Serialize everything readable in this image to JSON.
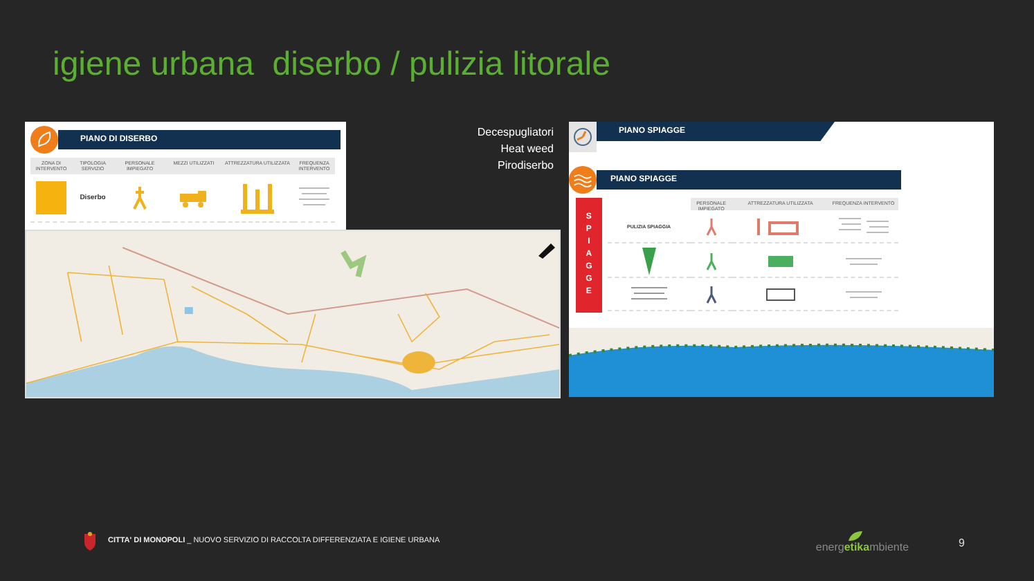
{
  "title": "igiene urbana  diserbo / pulizia litorale",
  "notes": [
    "Decespugliatori",
    "Heat weed",
    "Pirodiserbo"
  ],
  "left_panel": {
    "title": "PIANO DI DISERBO",
    "columns": [
      "ZONA DI INTERVENTO",
      "TIPOLOGIA SERVIZIO",
      "PERSONALE IMPIEGATO",
      "MEZZI UTILIZZATI",
      "ATTREZZATURA UTILIZZATA",
      "FREQUENZA INTERVENTO"
    ],
    "service": "Diserbo"
  },
  "right_panel": {
    "top_title": "PIANO SPIAGGE",
    "title": "PIANO SPIAGGE",
    "side_label": "SPIAGGE",
    "columns": [
      "PERSONALE IMPIEGATO",
      "ATTREZZATURA UTILIZZATA",
      "FREQUENZA INTERVENTO"
    ],
    "first_row": "PULIZIA SPIAGGIA"
  },
  "footer": {
    "text": "**CITTA' DI MONOPOLI** _ NUOVO SERVIZIO DI RACCOLTA DIFFERENZIATA E IGIENE URBANA",
    "logo": "energ**etika**mbiente",
    "page": "9"
  }
}
